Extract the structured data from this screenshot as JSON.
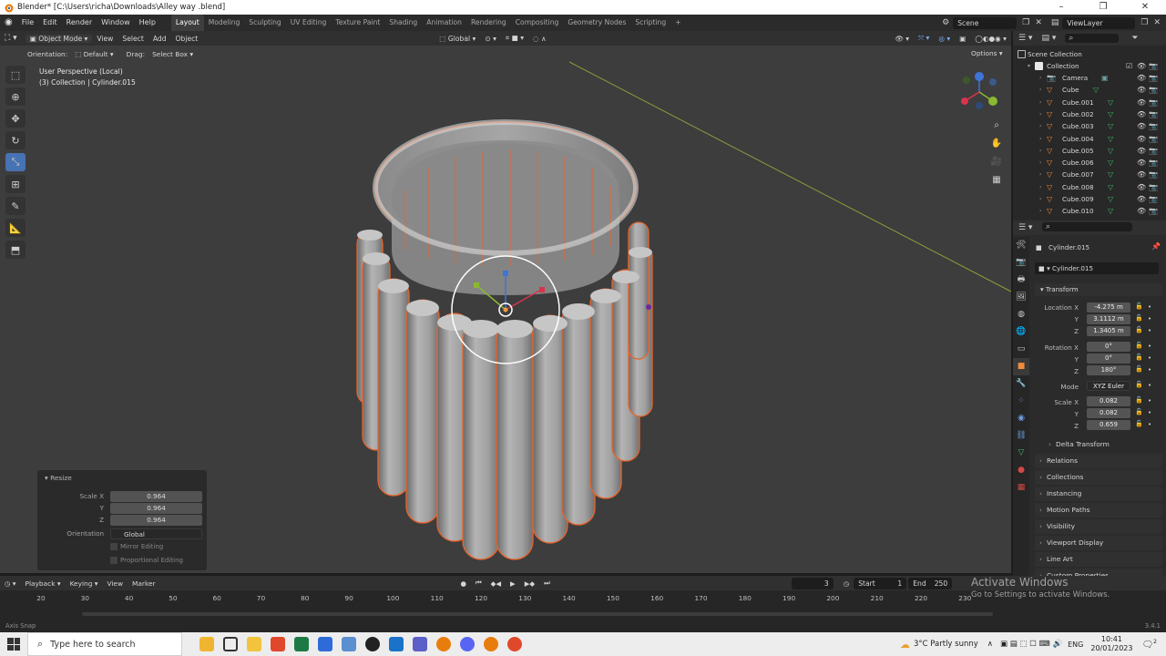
{
  "window": {
    "title": "Blender* [C:\\Users\\richa\\Downloads\\Alley way .blend]",
    "minimize": "–",
    "maximize": "❐",
    "close": "✕"
  },
  "menu": {
    "items": [
      "File",
      "Edit",
      "Render",
      "Window",
      "Help"
    ],
    "workspaces": [
      "Layout",
      "Modeling",
      "Sculpting",
      "UV Editing",
      "Texture Paint",
      "Shading",
      "Animation",
      "Rendering",
      "Compositing",
      "Geometry Nodes",
      "Scripting"
    ],
    "active_workspace": "Layout",
    "add_tab": "+",
    "scene": "Scene",
    "view_layer": "ViewLayer"
  },
  "viewport_header": {
    "mode": "Object Mode",
    "menus": [
      "View",
      "Select",
      "Add",
      "Object"
    ],
    "transform_orientation": "Global",
    "orientation_label": "Orientation:",
    "orientation_value": "Default",
    "drag_label": "Drag:",
    "drag_value": "Select Box",
    "options": "Options"
  },
  "viewport_info": {
    "line1": "User Perspective (Local)",
    "line2": "(3) Collection | Cylinder.015"
  },
  "resize_panel": {
    "title": "Resize",
    "rows": [
      {
        "label": "Scale X",
        "value": "0.964"
      },
      {
        "label": "Y",
        "value": "0.964"
      },
      {
        "label": "Z",
        "value": "0.964"
      }
    ],
    "orientation_label": "Orientation",
    "orientation_value": "Global",
    "mirror_editing": "Mirror Editing",
    "proportional_editing": "Proportional Editing"
  },
  "outliner": {
    "scene_collection": "Scene Collection",
    "collection": "Collection",
    "items": [
      "Camera",
      "Cube",
      "Cube.001",
      "Cube.002",
      "Cube.003",
      "Cube.004",
      "Cube.005",
      "Cube.006",
      "Cube.007",
      "Cube.008",
      "Cube.009",
      "Cube.010"
    ]
  },
  "properties": {
    "object_name": "Cylinder.015",
    "data_name": "Cylinder.015",
    "transform_title": "Transform",
    "location_label": "Location X",
    "location": [
      "-4.275 m",
      "3.1112 m",
      "1.3405 m"
    ],
    "rotation_label": "Rotation X",
    "rotation": [
      "0°",
      "0°",
      "180°"
    ],
    "mode_label": "Mode",
    "mode_value": "XYZ Euler",
    "scale_label": "Scale X",
    "scale": [
      "0.082",
      "0.082",
      "0.659"
    ],
    "y_label": "Y",
    "z_label": "Z",
    "sections": [
      "Delta Transform",
      "Relations",
      "Collections",
      "Instancing",
      "Motion Paths",
      "Visibility",
      "Viewport Display",
      "Line Art",
      "Custom Properties"
    ]
  },
  "timeline": {
    "menus": [
      "Playback",
      "Keying",
      "View",
      "Marker"
    ],
    "current_frame": "3",
    "start_label": "Start",
    "start_value": "1",
    "end_label": "End",
    "end_value": "250",
    "ticks": [
      "20",
      "30",
      "40",
      "50",
      "60",
      "70",
      "80",
      "90",
      "100",
      "110",
      "120",
      "130",
      "140",
      "150",
      "160",
      "170",
      "180",
      "190",
      "200",
      "210",
      "220",
      "230"
    ]
  },
  "statusbar": {
    "left": "Axis Snap",
    "version": "3.4.1"
  },
  "watermark": {
    "line1": "Activate Windows",
    "line2": "Go to Settings to activate Windows."
  },
  "taskbar": {
    "search_placeholder": "Type here to search",
    "weather": "3°C  Partly sunny",
    "time": "10:41",
    "date": "20/01/2023",
    "lang": "ENG",
    "notifications": "2"
  },
  "colors": {
    "accent": "#4772b3",
    "selection_outline": "#e8642c",
    "viewport_bg": "#3c3c3c"
  }
}
